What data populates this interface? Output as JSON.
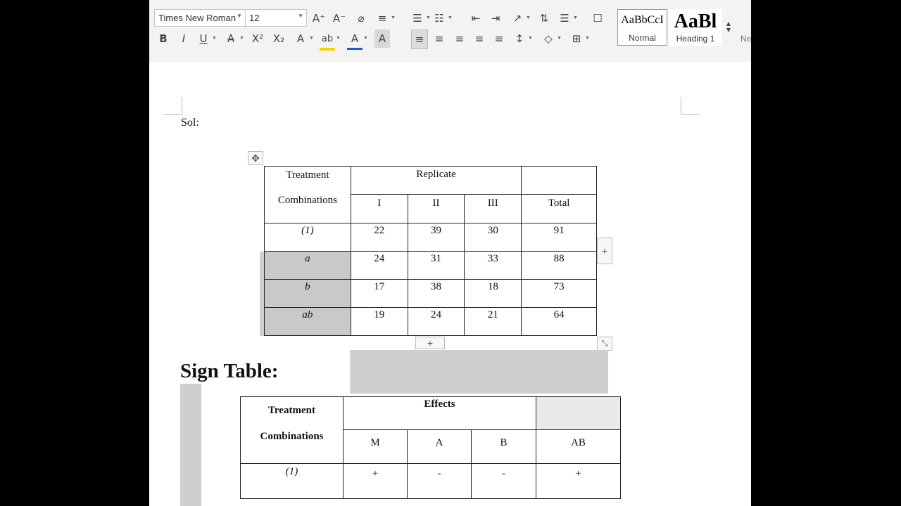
{
  "ribbon": {
    "font_name": "Times New Roman",
    "font_size": "12",
    "row1": [
      {
        "name": "grow-font-icon",
        "glyph": "A⁺"
      },
      {
        "name": "shrink-font-icon",
        "glyph": "A⁻"
      },
      {
        "name": "clear-format-icon",
        "glyph": "⌀"
      },
      {
        "name": "text-effects-icon",
        "glyph": "≡"
      },
      {
        "name": "bullets-icon",
        "glyph": "☰"
      },
      {
        "name": "numbering-icon",
        "glyph": "☷"
      },
      {
        "name": "decrease-indent-icon",
        "glyph": "⇤"
      },
      {
        "name": "increase-indent-icon",
        "glyph": "⇥"
      },
      {
        "name": "text-direction-icon",
        "glyph": "↗"
      },
      {
        "name": "sort-icon",
        "glyph": "⇅"
      },
      {
        "name": "line-spacing-icon",
        "glyph": "☰"
      },
      {
        "name": "show-marks-icon",
        "glyph": "☐"
      }
    ],
    "row2": [
      {
        "name": "bold-icon",
        "glyph": "B"
      },
      {
        "name": "italic-icon",
        "glyph": "I"
      },
      {
        "name": "underline-icon",
        "glyph": "U"
      },
      {
        "name": "strikethrough-icon",
        "glyph": "A"
      },
      {
        "name": "superscript-icon",
        "glyph": "X²"
      },
      {
        "name": "subscript-icon",
        "glyph": "X₂"
      },
      {
        "name": "font-effects-icon",
        "glyph": "A"
      },
      {
        "name": "highlight-icon",
        "glyph": "ab"
      },
      {
        "name": "font-color-icon",
        "glyph": "A"
      },
      {
        "name": "char-shading-icon",
        "glyph": "A"
      },
      {
        "name": "align-left-icon",
        "glyph": "≡"
      },
      {
        "name": "align-center-icon",
        "glyph": "≡"
      },
      {
        "name": "align-right-icon",
        "glyph": "≡"
      },
      {
        "name": "justify-icon",
        "glyph": "≡"
      },
      {
        "name": "distribute-icon",
        "glyph": "≡"
      },
      {
        "name": "paragraph-spacing-icon",
        "glyph": "↕"
      },
      {
        "name": "shading-icon",
        "glyph": "◇"
      },
      {
        "name": "borders-icon",
        "glyph": "⊞"
      }
    ],
    "styles": [
      {
        "preview": "AaBbCcI",
        "label": "Normal"
      },
      {
        "preview": "AaBl",
        "label": "Heading 1"
      }
    ],
    "styles_more": "Ne"
  },
  "colors": {
    "highlight": "#f3d400",
    "font_color": "#1e5cd6",
    "ribbon_bg": "#f3f3f3"
  },
  "document": {
    "sol": "Sol:",
    "table1": {
      "h_treat1": "Treatment",
      "h_treat2": "Combinations",
      "h_replicate": "Replicate",
      "h_total": "Total",
      "h_reps": [
        "I",
        "II",
        "III"
      ],
      "rows": [
        {
          "label": "(1)",
          "vals": [
            "22",
            "39",
            "30"
          ],
          "total": "91"
        },
        {
          "label": "a",
          "vals": [
            "24",
            "31",
            "33"
          ],
          "total": "88"
        },
        {
          "label": "b",
          "vals": [
            "17",
            "38",
            "18"
          ],
          "total": "73"
        },
        {
          "label": "ab",
          "vals": [
            "19",
            "24",
            "21"
          ],
          "total": "64"
        }
      ]
    },
    "sign_heading": "Sign Table:",
    "table2": {
      "h_treat1": "Treatment",
      "h_treat2": "Combinations",
      "h_effects": "Effects",
      "h_cols": [
        "M",
        "A",
        "B",
        "AB"
      ],
      "rows": [
        {
          "label": "(1)",
          "signs": [
            "+",
            "-",
            "-",
            "+"
          ]
        }
      ]
    },
    "handles": {
      "add_row": "+",
      "add_col": "+"
    }
  }
}
